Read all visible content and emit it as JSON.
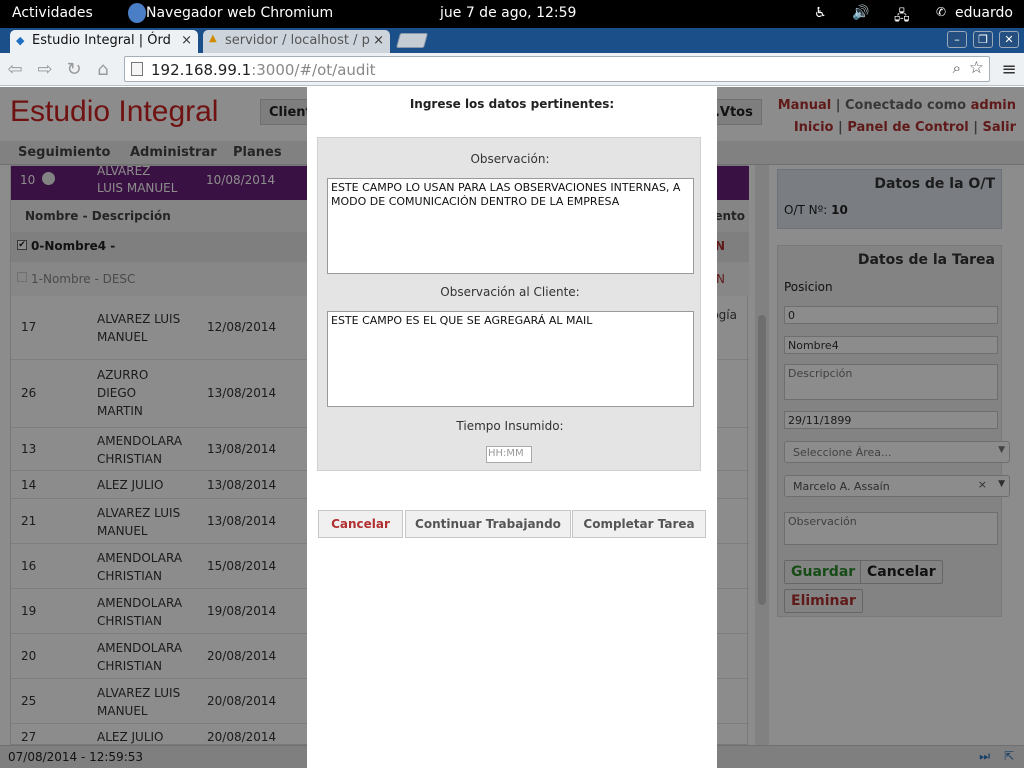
{
  "gnome": {
    "activities": "Actividades",
    "app": "Navegador web Chromium",
    "clock": "jue  7 de ago, 12:59",
    "user": "eduardo"
  },
  "tabs": [
    {
      "label": "Estudio Integral | Órd",
      "close": "×"
    },
    {
      "label": "servidor / localhost / p",
      "close": "×"
    }
  ],
  "address": {
    "host": "192.168.99.1",
    "path": ":3000/#/ot/audit"
  },
  "app": {
    "brand": "Estudio Integral",
    "client_button": "Client",
    "vtos_button": "st.Vtos",
    "manual": "Manual",
    "connected_as": "Conectado como",
    "user": "admin",
    "inicio": "Inicio",
    "panel": "Panel de Control",
    "salir": "Salir",
    "menu": [
      "Seguimiento",
      "Administrar",
      "Planes"
    ]
  },
  "list": {
    "ot_number": "10",
    "ot_name_1": "ALVAREZ",
    "ot_name_2": "LUIS MANUEL",
    "ot_date": "10/08/2014",
    "col_name": "Nombre - Descripción",
    "col_right": "ento",
    "task0": "0-Nombre4 -",
    "task0_right": "N",
    "task1": "1-Nombre - DESC",
    "task1_right": "N",
    "task_extra": "ogía",
    "rows": [
      {
        "id": "17",
        "name1": "ALVAREZ LUIS",
        "name2": "MANUEL",
        "name3": "",
        "date": "12/08/2014"
      },
      {
        "id": "26",
        "name1": "AZURRO",
        "name2": "DIEGO",
        "name3": "MARTIN",
        "date": "13/08/2014"
      },
      {
        "id": "13",
        "name1": "AMENDOLARA",
        "name2": "CHRISTIAN",
        "name3": "",
        "date": "13/08/2014"
      },
      {
        "id": "14",
        "name1": "ALEZ JULIO",
        "name2": "",
        "name3": "",
        "date": "13/08/2014"
      },
      {
        "id": "21",
        "name1": "ALVAREZ LUIS",
        "name2": "MANUEL",
        "name3": "",
        "date": "13/08/2014"
      },
      {
        "id": "16",
        "name1": "AMENDOLARA",
        "name2": "CHRISTIAN",
        "name3": "",
        "date": "15/08/2014"
      },
      {
        "id": "19",
        "name1": "AMENDOLARA",
        "name2": "CHRISTIAN",
        "name3": "",
        "date": "19/08/2014"
      },
      {
        "id": "20",
        "name1": "AMENDOLARA",
        "name2": "CHRISTIAN",
        "name3": "",
        "date": "20/08/2014"
      },
      {
        "id": "25",
        "name1": "ALVAREZ LUIS",
        "name2": "MANUEL",
        "name3": "",
        "date": "20/08/2014"
      },
      {
        "id": "27",
        "name1": "ALEZ JULIO",
        "name2": "",
        "name3": "",
        "date": "20/08/2014"
      }
    ]
  },
  "right": {
    "ot_title": "Datos de la O/T",
    "ot_label": "O/T Nº:",
    "ot_value": "10",
    "task_title": "Datos de la Tarea",
    "posicion_label": "Posicion",
    "posicion_value": "0",
    "nombre_value": "Nombre4",
    "descripcion_placeholder": "Descripción",
    "fecha_value": "29/11/1899",
    "area_placeholder": "Seleccione Área...",
    "user_value": "Marcelo A. Assaín",
    "obs_placeholder": "Observación",
    "guardar": "Guardar",
    "cancelar": "Cancelar",
    "eliminar": "Eliminar"
  },
  "status": {
    "text": "07/08/2014 - 12:59:53"
  },
  "modal": {
    "title": "Ingrese los datos pertinentes:",
    "obs_label": "Observación:",
    "obs_value": "ESTE CAMPO LO USAN PARA LAS OBSERVACIONES INTERNAS, A MODO DE COMUNICACIÓN DENTRO DE LA EMPRESA",
    "obs_client_label": "Observación al Cliente:",
    "obs_client_value": "ESTE CAMPO ES EL QUE SE AGREGARÁ AL MAIL",
    "time_label": "Tiempo Insumido:",
    "time_placeholder": "HH:MM",
    "cancel": "Cancelar",
    "continue": "Continuar Trabajando",
    "complete": "Completar Tarea"
  },
  "colors": {
    "brand": "#cc2222",
    "ot_row": "#6a1f7a",
    "overlay": "rgba(0,0,0,0.45)"
  }
}
